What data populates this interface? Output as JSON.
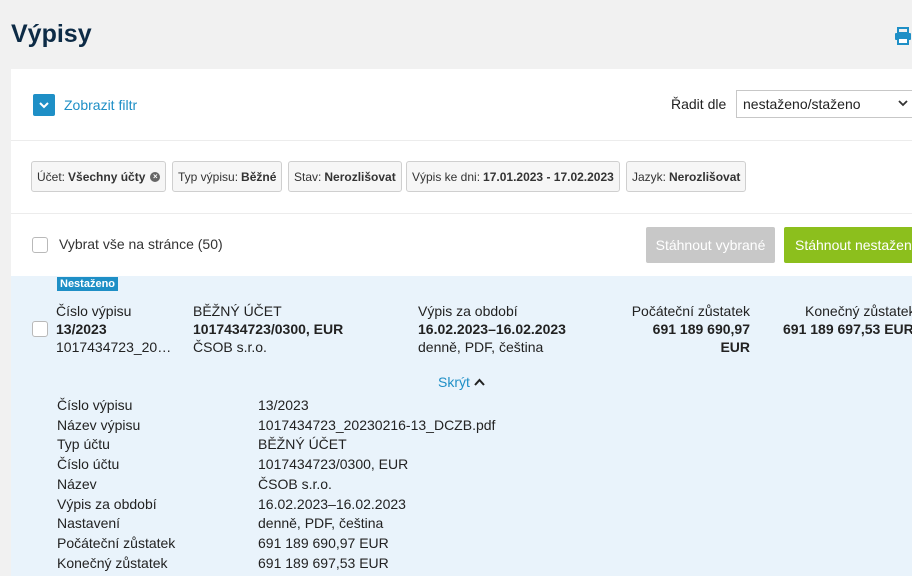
{
  "page": {
    "title": "Výpisy"
  },
  "filter": {
    "toggle_label": "Zobrazit filtr"
  },
  "sort": {
    "label": "Řadit dle",
    "selected": "nestaženo/staženo"
  },
  "chips": [
    {
      "key": "Účet:",
      "value": "Všechny účty"
    },
    {
      "key": "Typ výpisu:",
      "value": "Běžné"
    },
    {
      "key": "Stav:",
      "value": "Nerozlišovat"
    },
    {
      "key": "Výpis ke dni:",
      "value": "17.01.2023 - 17.02.2023"
    },
    {
      "key": "Jazyk:",
      "value": "Nerozlišovat"
    }
  ],
  "actions": {
    "select_all_label": "Vybrat vše na stránce (50)",
    "download_selected": "Stáhnout vybrané",
    "download_undownloaded": "Stáhnout nestažené"
  },
  "statement": {
    "status_badge": "Nestaženo",
    "number_label": "Číslo výpisu",
    "number": "13/2023",
    "file_short": "1017434723_20…",
    "account_type": "BĚŽNÝ ÚČET",
    "account": "1017434723/0300, EUR",
    "bank": "ČSOB s.r.o.",
    "period_label": "Výpis za období",
    "period": "16.02.2023–16.02.2023",
    "settings": "denně, PDF, čeština",
    "opening_label": "Počáteční zůstatek",
    "opening_amount": "691 189 690,97",
    "opening_currency": "EUR",
    "closing_label": "Konečný zůstatek",
    "closing_amount": "691 189 697,53 EUR",
    "hide_label": "Skrýt"
  },
  "details": [
    {
      "label": "Číslo výpisu",
      "value": "13/2023"
    },
    {
      "label": "Název výpisu",
      "value": "1017434723_20230216-13_DCZB.pdf"
    },
    {
      "label": "Typ účtu",
      "value": "BĚŽNÝ ÚČET"
    },
    {
      "label": "Číslo účtu",
      "value": "1017434723/0300, EUR"
    },
    {
      "label": "Název",
      "value": "ČSOB s.r.o."
    },
    {
      "label": "Výpis za období",
      "value": "16.02.2023–16.02.2023"
    },
    {
      "label": "Nastavení",
      "value": "denně, PDF, čeština"
    },
    {
      "label": "Počáteční zůstatek",
      "value": "691 189 690,97 EUR"
    },
    {
      "label": "Konečný zůstatek",
      "value": "691 189 697,53 EUR"
    }
  ],
  "colors": {
    "accent": "#1e8fc6",
    "title": "#0d2b46",
    "success": "#8cbf1d",
    "row_highlight": "#e9f3fb"
  },
  "icons": {
    "print": "print-icon",
    "filter_toggle": "chevron-down-icon",
    "sort": "chevron-down-icon",
    "chip_remove": "close-icon",
    "hide": "chevron-up-icon"
  }
}
